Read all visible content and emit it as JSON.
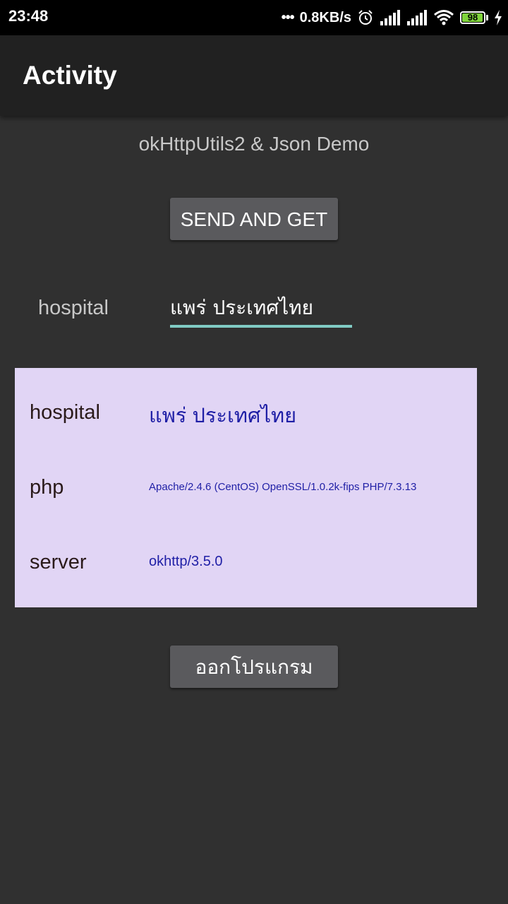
{
  "status_bar": {
    "time": "23:48",
    "dots": "•••",
    "net_speed": "0.8KB/s",
    "battery_level": "98",
    "icons": [
      "alarm-icon",
      "signal-icon",
      "signal-icon",
      "wifi-icon",
      "battery-icon",
      "charging-icon"
    ]
  },
  "app_bar": {
    "title": "Activity"
  },
  "main": {
    "demo_title": "okHttpUtils2 & Json Demo",
    "send_button_label": "SEND AND GET",
    "input_label": "hospital",
    "input_value": "แพร่ ประเทศไทย",
    "exit_button_label": "ออกโปรแกรม"
  },
  "results": [
    {
      "key": "hospital",
      "value": "แพร่ ประเทศไทย"
    },
    {
      "key": "php",
      "value": "Apache/2.4.6 (CentOS) OpenSSL/1.0.2k-fips PHP/7.3.13"
    },
    {
      "key": "server",
      "value": "okhttp/3.5.0"
    }
  ],
  "colors": {
    "background": "#303030",
    "app_bar": "#212121",
    "accent": "#80cbc4",
    "card": "#e1d5f5",
    "value_text": "#1f1fa6",
    "button": "#5a5a5d",
    "battery": "#7fd33b"
  }
}
